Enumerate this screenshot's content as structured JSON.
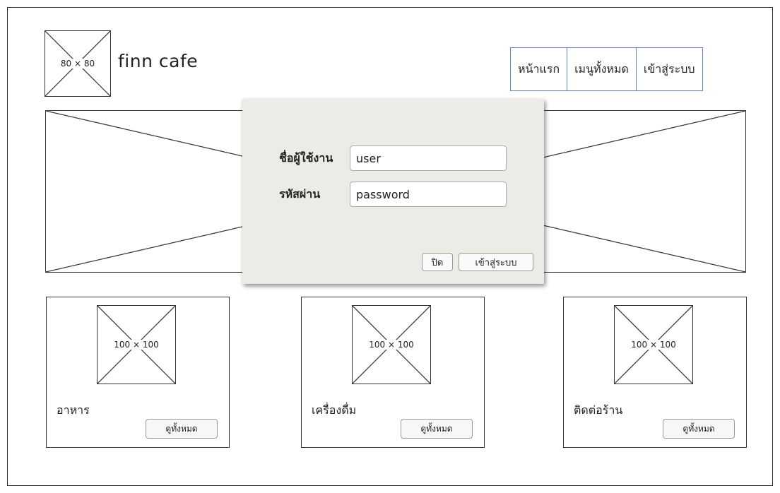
{
  "header": {
    "logo_label": "80 × 80",
    "brand": "finn cafe",
    "nav": [
      "หน้าแรก",
      "เมนูทั้งหมด",
      "เข้าสู่ระบบ"
    ]
  },
  "cards": [
    {
      "image_label": "100 × 100",
      "title": "อาหาร",
      "button": "ดูทั้งหมด"
    },
    {
      "image_label": "100 × 100",
      "title": "เครื่องดื่ม",
      "button": "ดูทั้งหมด"
    },
    {
      "image_label": "100 × 100",
      "title": "ติดต่อร้าน",
      "button": "ดูทั้งหมด"
    }
  ],
  "login_modal": {
    "username_label": "ชื่อผู้ใช้งาน",
    "username_value": "user",
    "password_label": "รหัสผ่าน",
    "password_value": "password",
    "close_button": "ปิด",
    "login_button": "เข้าสู่ระบบ"
  }
}
